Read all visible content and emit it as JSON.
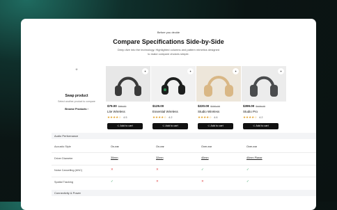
{
  "header": {
    "kicker": "Before you decide",
    "title": "Compare Specifications Side-by-Side",
    "subtitle": "Deep dive into the technology. Highlighted columns and pattern mimetics designed to make compare choices simple."
  },
  "swap": {
    "plus_glyph": "+",
    "heading": "Swap product",
    "description": "Select another product to compare",
    "browse_label": "Browse Products"
  },
  "products": [
    {
      "price": "$79.00",
      "old_price": "$99.00",
      "name": "Lite Wireless",
      "stars": "★★★★☆",
      "rating": "4.5",
      "cart_label": "Add to cart",
      "color": "#3a3a3a",
      "bg": "#e7e7e7"
    },
    {
      "price": "$129.00",
      "old_price": "",
      "name": "Essential Wireless",
      "stars": "★★★★☆",
      "rating": "4.2",
      "cart_label": "Add to cart",
      "color": "#1d1f1e",
      "bg": "#f1f1f1"
    },
    {
      "price": "$220.00",
      "old_price": "$250.00",
      "name": "Studio Wireless",
      "stars": "★★★★☆",
      "rating": "4.6",
      "cart_label": "Add to cart",
      "color": "#d9b785",
      "bg": "#ede6da"
    },
    {
      "price": "$399.00",
      "old_price": "$499.00",
      "name": "Studio Pro",
      "stars": "★★★★☆",
      "rating": "4.2",
      "cart_label": "Add to cart",
      "color": "#4a4c4e",
      "bg": "#ececec"
    }
  ],
  "sections": [
    {
      "title": "Audio Performance"
    },
    {
      "title": "Connectivity & Power"
    }
  ],
  "rows": [
    {
      "label": "Acoustic Style",
      "values": [
        "On-ear",
        "On-ear",
        "Over-ear",
        "Over-ear"
      ],
      "underline": false
    },
    {
      "label": "Driver Diameter",
      "values": [
        "30mm",
        "32mm",
        "40mm",
        "40mm Planar"
      ],
      "underline": true
    },
    {
      "label": "Noise Cancelling (ANC)",
      "values": [
        "✕",
        "✕",
        "✓",
        "✓"
      ],
      "underline": false
    },
    {
      "label": "Spatial Tracking",
      "values": [
        "✓",
        "✕",
        "✕",
        "✓"
      ],
      "underline": false
    }
  ],
  "icons": {
    "favorite": "sparkle-icon",
    "cart": "cart-icon",
    "chevron": "chevron-right-icon"
  }
}
